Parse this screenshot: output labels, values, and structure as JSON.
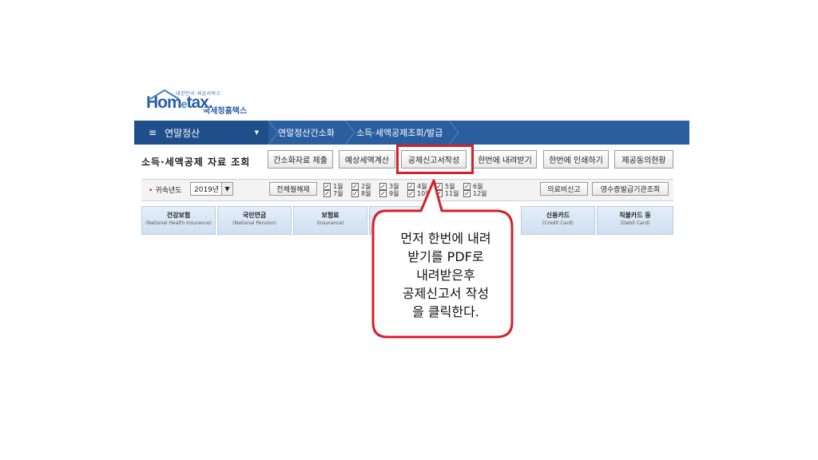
{
  "logo": {
    "brand": "Hom",
    "brand_e": "e",
    "brand_tax": "tax.",
    "kr_name": "국세청홈택스",
    "small": "대한민국 세금서비스"
  },
  "nav": {
    "menu_label": "연말정산",
    "crumbs": [
      "연말정산간소화",
      "소득·세액공제조회/발급"
    ]
  },
  "page": {
    "title": "소득·세액공제 자료 조회"
  },
  "toolbar": {
    "buttons": [
      "간소화자료 제출",
      "예상세액계산",
      "공제신고서작성",
      "한번에 내려받기",
      "한번에 인쇄하기",
      "제공동의현황"
    ]
  },
  "filter": {
    "year_label": "귀속년도",
    "year_value": "2019년",
    "release_all": "전체월해제",
    "months": [
      "1월",
      "2월",
      "3월",
      "4월",
      "5월",
      "6월",
      "7월",
      "8월",
      "9월",
      "10월",
      "11월",
      "12월"
    ],
    "medical": "의료비신고",
    "receipt": "영수증발급기관조회"
  },
  "tabs": [
    {
      "ko": "건강보험",
      "en": "(National Health Insurance)"
    },
    {
      "ko": "국민연금",
      "en": "(National Pension)"
    },
    {
      "ko": "보험료",
      "en": "(Insurance)"
    },
    {
      "ko": "",
      "en": ""
    },
    {
      "ko": "신용카드",
      "en": "(Credit Card)"
    },
    {
      "ko": "직불카드 등",
      "en": "(Debit Card)"
    }
  ],
  "callout": {
    "lines": [
      "먼저 한번에 내려",
      "받기를 PDF로",
      "내려받은후",
      "공제신고서 작성",
      "을 클릭한다."
    ]
  },
  "colors": {
    "nav": "#2a5e9e",
    "highlight": "#d62028",
    "tab": "#dbe8f6"
  }
}
